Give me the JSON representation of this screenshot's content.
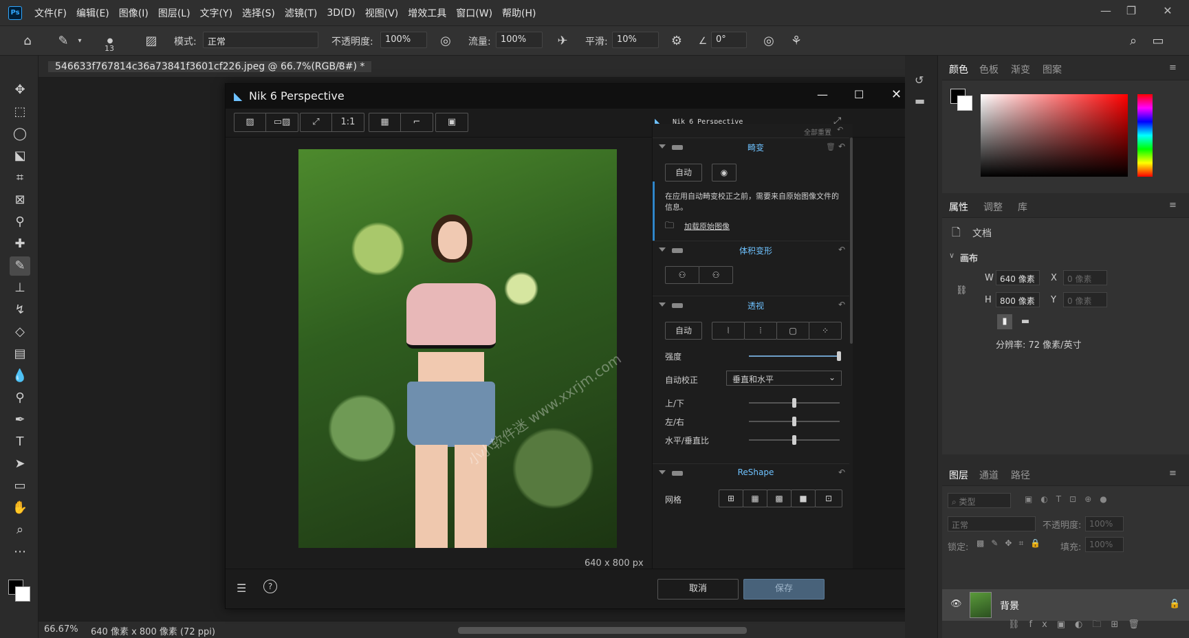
{
  "app": {
    "logo": "Ps",
    "menu": [
      "文件(F)",
      "编辑(E)",
      "图像(I)",
      "图层(L)",
      "文字(Y)",
      "选择(S)",
      "滤镜(T)",
      "3D(D)",
      "视图(V)",
      "增效工具",
      "窗口(W)",
      "帮助(H)"
    ]
  },
  "options": {
    "brush_size": "13",
    "mode_label": "模式:",
    "mode_value": "正常",
    "opacity_label": "不透明度:",
    "opacity_value": "100%",
    "flow_label": "流量:",
    "flow_value": "100%",
    "smooth_label": "平滑:",
    "smooth_value": "10%",
    "angle_value": "0°"
  },
  "document": {
    "tab_title": "546633f767814c36a73841f3601cf226.jpeg @ 66.7%(RGB/8#) *",
    "zoom": "66.67%",
    "size": "640 像素 x 800 像素 (72 ppi)"
  },
  "dialog": {
    "title": "Nik 6 Perspective",
    "brand": "Nik 6 Perspective",
    "zoom_one": "1:1",
    "reset_all": "全部重置",
    "dimensions": "640 x 800 px",
    "watermark": "小小软件迷 www.xxrjm.com",
    "sections": {
      "distortion": {
        "title": "畸变",
        "auto": "自动",
        "info": "在应用自动畸变校正之前，需要来自原始图像文件的信息。",
        "load_link": "加载原始图像"
      },
      "volume": {
        "title": "体积变形"
      },
      "perspective": {
        "title": "透视",
        "auto": "自动",
        "strength_label": "强度",
        "strength": 1.0,
        "auto_correct_label": "自动校正",
        "auto_correct_value": "垂直和水平",
        "updown_label": "上/下",
        "updown": 0.5,
        "leftright_label": "左/右",
        "leftright": 0.5,
        "ratio_label": "水平/垂直比",
        "ratio": 0.5
      },
      "reshape": {
        "title": "ReShape",
        "grid_label": "网格"
      }
    },
    "cancel": "取消",
    "save": "保存"
  },
  "right": {
    "color_tabs": [
      "颜色",
      "色板",
      "渐变",
      "图案"
    ],
    "prop_tabs": [
      "属性",
      "调整",
      "库"
    ],
    "doc_label": "文档",
    "canvas_label": "画布",
    "w_label": "W",
    "w_value": "640 像素",
    "h_label": "H",
    "h_value": "800 像素",
    "x_label": "X",
    "x_value": "0 像素",
    "y_label": "Y",
    "y_value": "0 像素",
    "resolution": "分辨率: 72 像素/英寸",
    "layer_tabs": [
      "图层",
      "通道",
      "路径"
    ],
    "filter_placeholder": "类型",
    "blend_mode": "正常",
    "opacity_label": "不透明度:",
    "opacity_value": "100%",
    "lock_label": "锁定:",
    "fill_label": "填充:",
    "fill_value": "100%",
    "layer_name": "背景"
  }
}
